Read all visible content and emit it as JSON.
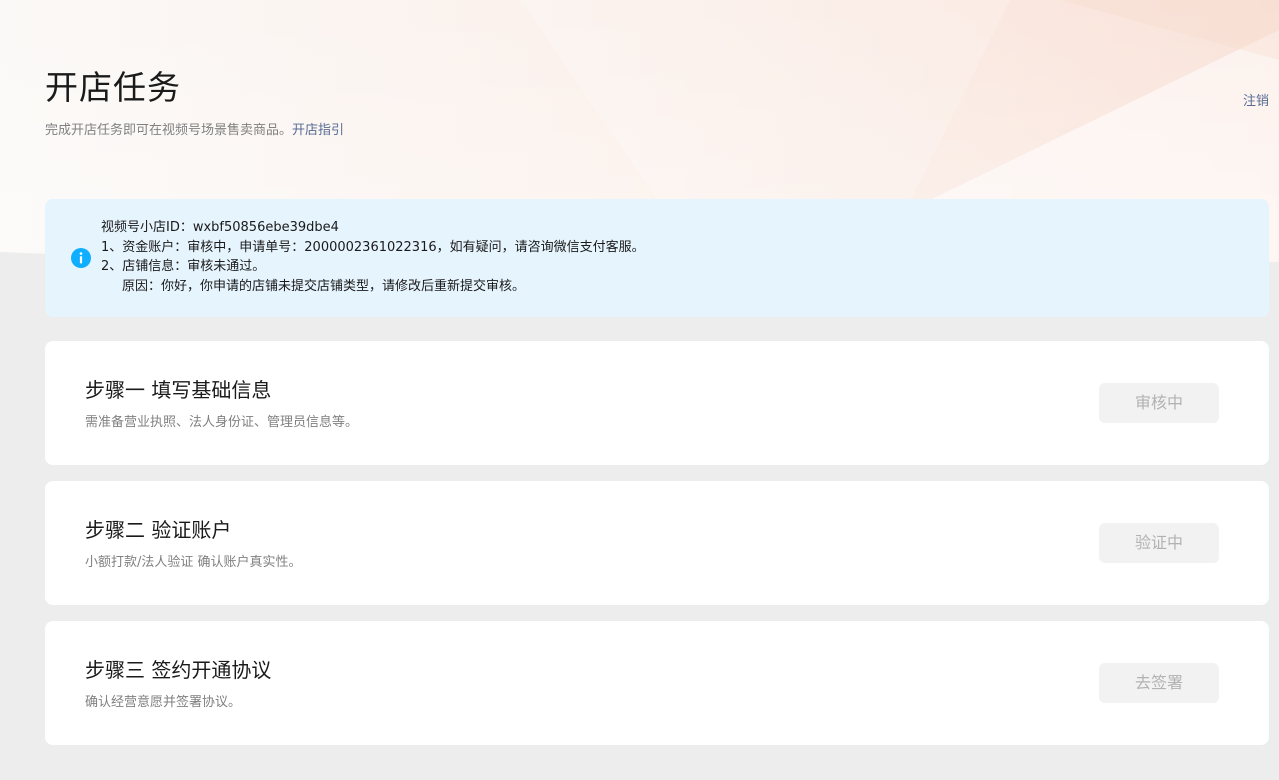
{
  "header": {
    "title": "开店任务",
    "subtitle": "完成开店任务即可在视频号场景售卖商品。",
    "guide_link": "开店指引",
    "logout": "注销"
  },
  "notice": {
    "icon": "info-icon",
    "shop_id_line": "视频号小店ID：wxbf50856ebe39dbe4",
    "line_1": "1、资金账户：审核中，申请单号：2000002361022316，如有疑问，请咨询微信支付客服。",
    "line_2": "2、店铺信息：审核未通过。",
    "line_3": "原因：你好，你申请的店铺未提交店铺类型，请修改后重新提交审核。"
  },
  "steps": [
    {
      "title": "步骤一 填写基础信息",
      "desc": "需准备营业执照、法人身份证、管理员信息等。",
      "button": "审核中"
    },
    {
      "title": "步骤二 验证账户",
      "desc": "小额打款/法人验证 确认账户真实性。",
      "button": "验证中"
    },
    {
      "title": "步骤三 签约开通协议",
      "desc": "确认经营意愿并签署协议。",
      "button": "去签署"
    }
  ],
  "colors": {
    "link": "#576b95",
    "notice_bg": "#e6f4fd",
    "info_icon": "#10aeff",
    "disabled_button_bg": "#f2f2f2",
    "disabled_button_text": "#b2b2b2",
    "page_bg": "#ededed"
  }
}
